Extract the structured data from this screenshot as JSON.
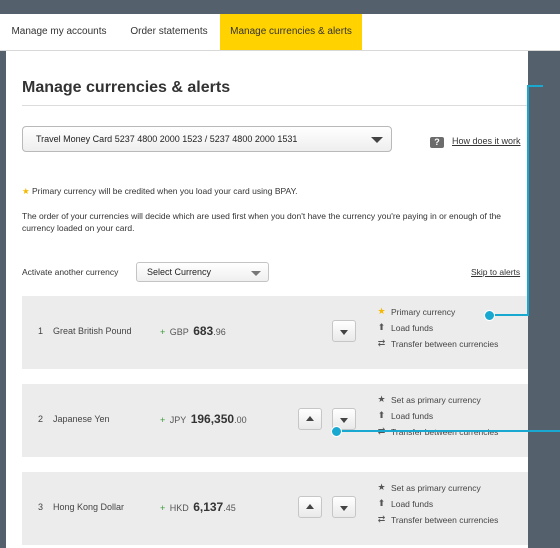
{
  "tabs": [
    {
      "label": "Manage my accounts",
      "active": false
    },
    {
      "label": "Order statements",
      "active": false
    },
    {
      "label": "Manage currencies & alerts",
      "active": true
    }
  ],
  "page": {
    "title": "Manage currencies & alerts"
  },
  "card_select": {
    "value": "Travel Money Card 5237 4800 2000 1523 / 5237 4800 2000 1531"
  },
  "help": {
    "label": "How does it work",
    "icon": "?"
  },
  "notes": {
    "primary": "Primary currency will be credited when you load your card using BPAY.",
    "order": "The order of your currencies will decide which are used first when you don't have the currency you're paying in or enough of the currency loaded on your card."
  },
  "activate": {
    "label": "Activate another currency",
    "select_value": "Select Currency",
    "skip_link": "Skip to alerts"
  },
  "currencies": [
    {
      "index": "1",
      "name": "Great British Pound",
      "plus": "+",
      "code": "GBP",
      "whole": "683",
      "cents": ".96",
      "actions": [
        "Primary currency",
        "Load funds",
        "Transfer between currencies"
      ]
    },
    {
      "index": "2",
      "name": "Japanese Yen",
      "plus": "+",
      "code": "JPY",
      "whole": "196,350",
      "cents": ".00",
      "actions": [
        "Set as primary currency",
        "Load funds",
        "Transfer between currencies"
      ]
    },
    {
      "index": "3",
      "name": "Hong Kong Dollar",
      "plus": "+",
      "code": "HKD",
      "whole": "6,137",
      "cents": ".45",
      "actions": [
        "Set as primary currency",
        "Load funds",
        "Transfer between currencies"
      ]
    }
  ],
  "colors": {
    "accent": "#ffd200",
    "callout": "#19a8d0",
    "star": "#f5b800",
    "positive": "#3a9a3a"
  }
}
